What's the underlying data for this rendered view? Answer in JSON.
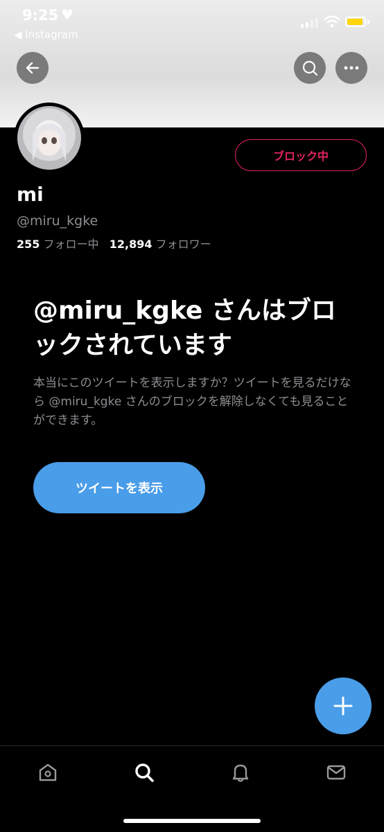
{
  "status_bar": {
    "time": "9:25",
    "heart": "♥",
    "back_app": "◀ Instagram",
    "battery_color": "#ffd60a"
  },
  "header": {
    "back_icon": "arrow-left-icon",
    "search_icon": "search-icon",
    "more_icon": "more-horizontal-icon"
  },
  "profile": {
    "name": "mi",
    "handle": "@miru_kgke",
    "following_count": "255",
    "following_label": "フォロー中",
    "followers_count": "12,894",
    "followers_label": "フォロワー",
    "block_button_label": "ブロック中"
  },
  "blocked_notice": {
    "headline": "@miru_kgke さんはブロックされています",
    "body": "本当にこのツイートを表示しますか？ツイートを見るだけなら @miru_kgke さんのブロックを解除しなくても見ることができます。",
    "show_button_label": "ツイートを表示"
  },
  "fab": {
    "icon": "plus-icon"
  },
  "tab_bar": {
    "items": [
      "home-icon",
      "search-icon",
      "notifications-bell-icon",
      "messages-envelope-icon"
    ]
  },
  "colors": {
    "accent_blue": "#4a9de8",
    "blocked_red": "#e0245e",
    "secondary_text": "#8e8e93",
    "background": "#000000"
  }
}
